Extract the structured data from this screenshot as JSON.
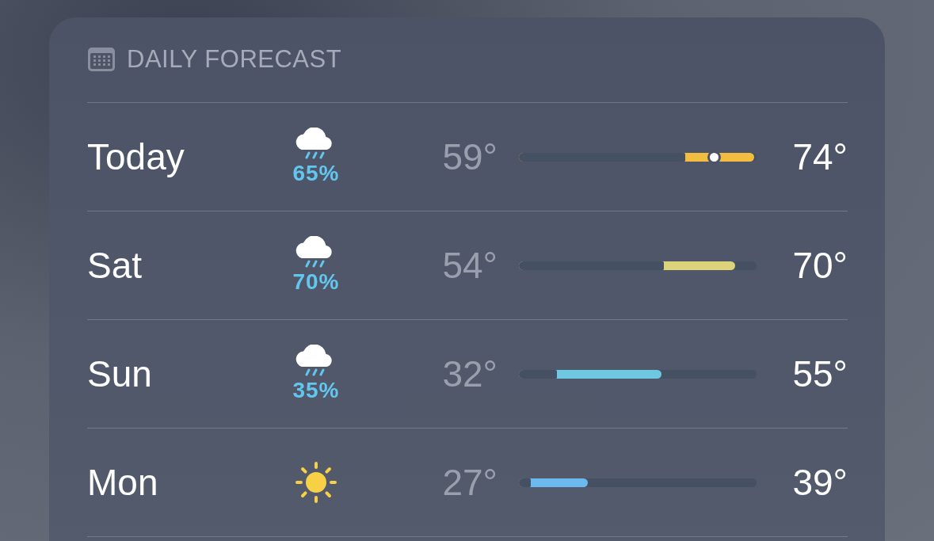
{
  "header": {
    "title": "DAILY FORECAST"
  },
  "days": [
    {
      "day": "Today",
      "kind": "rain",
      "precip": "65%",
      "low": "59°",
      "high": "74°",
      "color": "#f3be3f",
      "range": {
        "from": {
          "level": 0.69
        },
        "to": {
          "level": 0.99
        }
      },
      "current": {
        "level": 0.82
      }
    },
    {
      "day": "Sat",
      "kind": "rain",
      "precip": "70%",
      "low": "54°",
      "high": "70°",
      "color": "#dcd37a",
      "range": {
        "from": {
          "level": 0.6
        },
        "to": {
          "level": 0.91
        }
      }
    },
    {
      "day": "Sun",
      "kind": "rain",
      "precip": "35%",
      "low": "32°",
      "high": "55°",
      "color": "#6ec8e2",
      "range": {
        "from": {
          "level": 0.15
        },
        "to": {
          "level": 0.6
        }
      }
    },
    {
      "day": "Mon",
      "kind": "sun",
      "low": "27°",
      "high": "39°",
      "color": "#6bb9ef",
      "range": {
        "from": {
          "level": 0.04
        },
        "to": {
          "level": 0.29
        }
      }
    }
  ]
}
